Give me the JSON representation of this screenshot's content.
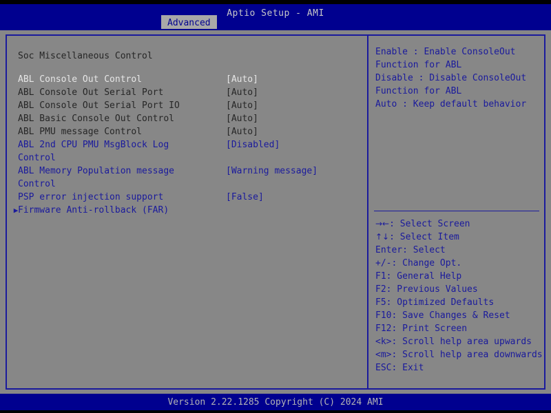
{
  "header": {
    "title": "Aptio Setup - AMI",
    "tabs": [
      {
        "label": "Advanced",
        "active": true
      }
    ]
  },
  "main": {
    "section_title": "Soc Miscellaneous Control",
    "items": [
      {
        "label": "ABL Console Out Control",
        "value": "[Auto]",
        "state": "selected",
        "submenu": false
      },
      {
        "label": "ABL Console Out Serial Port",
        "value": "[Auto]",
        "state": "normal",
        "submenu": false
      },
      {
        "label": "ABL Console Out Serial Port IO",
        "value": "[Auto]",
        "state": "normal",
        "submenu": false
      },
      {
        "label": "ABL Basic Console Out Control",
        "value": "[Auto]",
        "state": "normal",
        "submenu": false
      },
      {
        "label": "ABL PMU message Control",
        "value": "[Auto]",
        "state": "normal",
        "submenu": false
      },
      {
        "label": "ABL 2nd CPU PMU MsgBlock Log",
        "value": "[Disabled]",
        "state": "active",
        "submenu": false
      },
      {
        "label": "Control",
        "value": "",
        "state": "active",
        "submenu": false
      },
      {
        "label": "ABL Memory Population message",
        "value": "[Warning message]",
        "state": "active",
        "submenu": false
      },
      {
        "label": "Control",
        "value": "",
        "state": "active",
        "submenu": false
      },
      {
        "label": "PSP error injection support",
        "value": "[False]",
        "state": "active",
        "submenu": false
      },
      {
        "label": "Firmware Anti-rollback (FAR)",
        "value": "",
        "state": "active",
        "submenu": true
      }
    ]
  },
  "help": {
    "lines": [
      "Enable : Enable ConsoleOut",
      "Function for ABL",
      "Disable : Disable ConsoleOut",
      "Function for ABL",
      "Auto : Keep default behavior"
    ]
  },
  "keys": [
    {
      "glyph": "→←",
      "text": ": Select Screen"
    },
    {
      "glyph": "↑↓",
      "text": ": Select Item"
    },
    {
      "glyph": "",
      "text": "Enter: Select"
    },
    {
      "glyph": "",
      "text": "+/-: Change Opt."
    },
    {
      "glyph": "",
      "text": "F1: General Help"
    },
    {
      "glyph": "",
      "text": "F2: Previous Values"
    },
    {
      "glyph": "",
      "text": "F5: Optimized Defaults"
    },
    {
      "glyph": "",
      "text": "F10: Save Changes & Reset"
    },
    {
      "glyph": "",
      "text": "F12: Print Screen"
    },
    {
      "glyph": "",
      "text": "<k>: Scroll help area upwards"
    },
    {
      "glyph": "",
      "text": "<m>: Scroll help area downwards"
    },
    {
      "glyph": "",
      "text": "ESC: Exit"
    }
  ],
  "footer": {
    "version_text": "Version 2.22.1285 Copyright (C) 2024 AMI"
  },
  "icons": {
    "submenu_arrow": "▶"
  },
  "colors": {
    "header_blue": "#00008f",
    "panel_gray": "#878787",
    "border_blue": "#1a1a9c",
    "text_dark": "#262626",
    "text_selected": "#e6e6e6",
    "footer_text": "#b4b4b4"
  }
}
